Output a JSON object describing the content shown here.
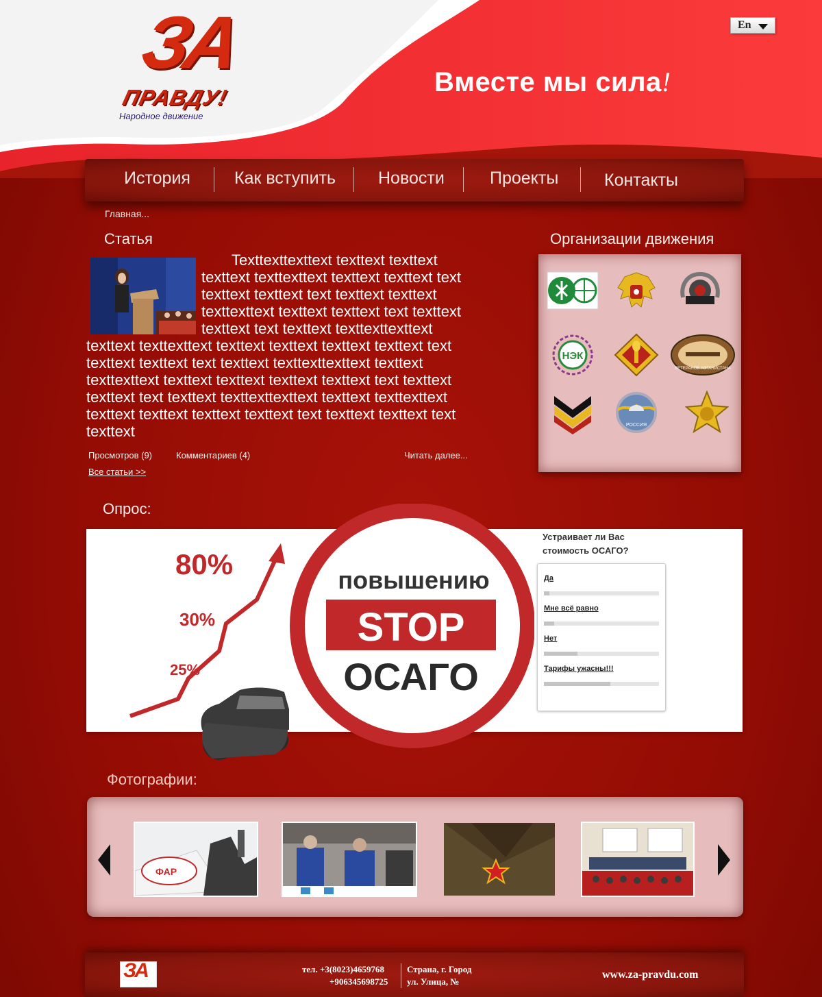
{
  "header": {
    "logo_main": "ЗА",
    "logo_sub": "ПРАВДУ!",
    "logo_tagline": "Народное движение",
    "slogan": "Вместе мы сила",
    "slogan_excl": "!",
    "language": "En"
  },
  "nav": {
    "items": [
      {
        "label": "История"
      },
      {
        "label": "Как вступить"
      },
      {
        "label": "Новости"
      },
      {
        "label": "Проекты"
      },
      {
        "label": "Контакты"
      }
    ]
  },
  "breadcrumb": "Главная...",
  "article": {
    "section_title": "Статья",
    "text": "Texttexttexttext texttext texttext texttext texttexttext texttext texttext text texttext texttext text texttext texttext texttexttext texttext texttext text texttext texttext text texttext texttexttexttext texttext texttexttext texttext texttext texttext texttext text texttext texttext text texttext texttexttexttext texttext texttexttext texttext texttext texttext texttext text texttext texttext text texttext texttexttexttext texttext texttexttext texttext texttext texttext texttext text texttext texttext text texttext",
    "views": "Просмотров (9)",
    "comments": "Комментариев (4)",
    "read_more": "Читать далее...",
    "all_articles": "Все статьи >>"
  },
  "orgs": {
    "section_title": "Организации движения",
    "items": [
      {
        "icon": "oak-leaf-globe-emblem"
      },
      {
        "icon": "double-eagle-emblem"
      },
      {
        "icon": "wreath-emblem"
      },
      {
        "icon": "nek-emblem",
        "text": "НЭК"
      },
      {
        "icon": "torch-emblem"
      },
      {
        "icon": "veterans-afghanistan-emblem",
        "text": "ВЕТЕРАНОВ АФГАНИСТАНА"
      },
      {
        "icon": "chevron-emblem"
      },
      {
        "icon": "paratroopers-emblem",
        "text": "РОССИЯ"
      },
      {
        "icon": "gold-star-emblem"
      }
    ]
  },
  "poll": {
    "section_title": "Опрос:",
    "banner": {
      "pct_high": "80%",
      "pct_mid": "30%",
      "pct_low": "25%",
      "top_word": "повышению",
      "stop_word": "STOP",
      "bottom_word": "ОСАГО"
    },
    "question": "Устраивает ли Вас стоимость ОСАГО?",
    "options": [
      {
        "label": "Да",
        "share": 0.05
      },
      {
        "label": "Мне всё равно",
        "share": 0.09
      },
      {
        "label": "Нет",
        "share": 0.29
      },
      {
        "label": "Тарифы ужасны!!!",
        "share": 0.58
      }
    ]
  },
  "photos": {
    "section_title": "Фотографии:",
    "items": [
      {
        "icon": "monument-flag-photo"
      },
      {
        "icon": "street-volunteers-photo"
      },
      {
        "icon": "red-star-uniform-photo"
      },
      {
        "icon": "conference-hall-photo"
      }
    ]
  },
  "footer": {
    "logo_text": "ЗА",
    "phone_1": "тел. +3(8023)4659768",
    "phone_2": "+906345698725",
    "address_1": "Страна, г. Город",
    "address_2": "ул. Улица, №",
    "website": "www.za-pravdu.com"
  },
  "colors": {
    "brand_red": "#d42a10",
    "page_red": "#9c1006",
    "panel_pink": "#e7bcbc"
  }
}
